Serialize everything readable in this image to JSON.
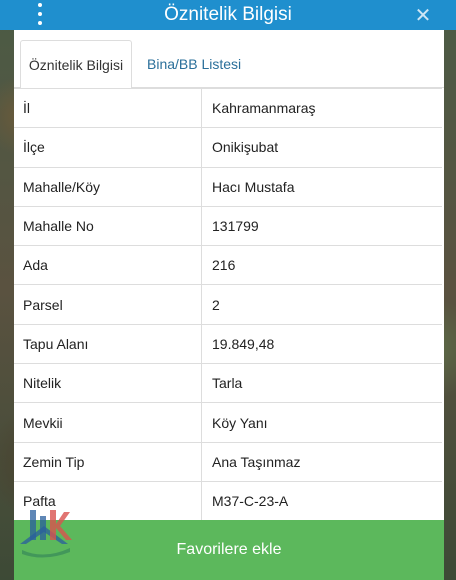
{
  "header": {
    "title": "Öznitelik Bilgisi"
  },
  "tabs": [
    {
      "label": "Öznitelik Bilgisi",
      "active": true
    },
    {
      "label": "Bina/BB Listesi",
      "active": false
    }
  ],
  "attributes": [
    {
      "label": "İl",
      "value": "Kahramanmaraş"
    },
    {
      "label": "İlçe",
      "value": "Onikişubat"
    },
    {
      "label": "Mahalle/Köy",
      "value": "Hacı Mustafa"
    },
    {
      "label": "Mahalle No",
      "value": "131799"
    },
    {
      "label": "Ada",
      "value": "216"
    },
    {
      "label": "Parsel",
      "value": "2"
    },
    {
      "label": "Tapu Alanı",
      "value": "19.849,48"
    },
    {
      "label": "Nitelik",
      "value": "Tarla"
    },
    {
      "label": "Mevkii",
      "value": "Köy Yanı"
    },
    {
      "label": "Zemin Tip",
      "value": "Ana Taşınmaz"
    },
    {
      "label": "Pafta",
      "value": "M37-C-23-A"
    }
  ],
  "actions": {
    "favorite_label": "Favorilere ekle"
  },
  "colors": {
    "header": "#1f8fce",
    "favorite_button": "#5cb85c",
    "tab_link": "#2a6f9a"
  },
  "icons": {
    "menu": "menu-dots-icon",
    "close": "close-icon"
  }
}
